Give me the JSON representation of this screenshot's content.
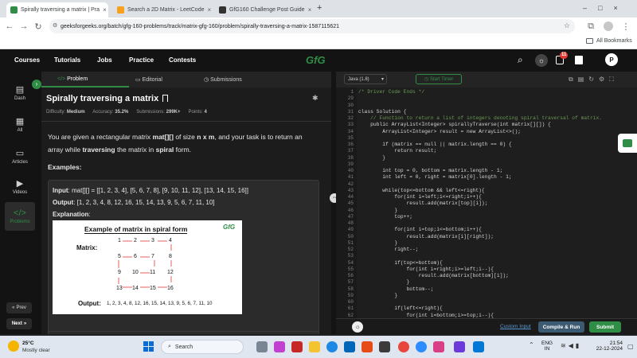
{
  "browser": {
    "tabs": [
      {
        "title": "Spirally traversing a matrix | Pra",
        "active": true,
        "favicon_color": "#2f8d46"
      },
      {
        "title": "Search a 2D Matrix - LeetCode",
        "active": false,
        "favicon_color": "#f89f1b"
      },
      {
        "title": "GfG160 Challenge Post Guide",
        "active": false,
        "favicon_color": "#333333"
      }
    ],
    "new_tab": "+",
    "url": "geeksforgeeks.org/batch/gfg-160-problems/track/matrix-gfg-160/problem/spirally-traversing-a-matrix-1587115621",
    "all_bookmarks": "All Bookmarks"
  },
  "gfg_nav": {
    "items": [
      "Courses",
      "Tutorials",
      "Jobs",
      "Practice",
      "Contests"
    ],
    "logo": "GfG",
    "notification_count": "11",
    "avatar": "P"
  },
  "rail": {
    "items": [
      {
        "label": "Dash",
        "icon": "dashboard-icon"
      },
      {
        "label": "All",
        "icon": "all-icon"
      },
      {
        "label": "Articles",
        "icon": "articles-icon"
      },
      {
        "label": "Videos",
        "icon": "videos-icon"
      },
      {
        "label": "Problems",
        "icon": "problems-icon"
      }
    ],
    "prev": "Prev",
    "next": "Next"
  },
  "problem": {
    "tabs": [
      "Problem",
      "Editorial",
      "Submissions"
    ],
    "title": "Spirally traversing a matrix",
    "meta": {
      "difficulty_label": "Difficulty:",
      "difficulty": "Medium",
      "accuracy_label": "Accuracy:",
      "accuracy": "35.2%",
      "submissions_label": "Submissions:",
      "submissions": "299K+",
      "points_label": "Points:",
      "points": "4"
    },
    "statement_parts": {
      "p1": "You are given a rectangular matrix ",
      "b1": "mat[][]",
      "p2": " of size ",
      "b2": "n x m",
      "p3": ", and your task is to return an array while ",
      "b3": "traversing",
      "p4": " the matrix in ",
      "b4": "spiral",
      "p5": " form."
    },
    "examples_label": "Examples:",
    "example": {
      "input_label": "Input",
      "input": ":  mat[][] = [[1, 2, 3, 4], [5, 6, 7, 8], [9, 10, 11, 12], [13, 14, 15, 16]]",
      "output_label": "Output",
      "output": ":  [1, 2, 3, 4, 8, 12, 16, 15, 14, 13, 9, 5, 6, 7, 11, 10]",
      "explanation_label": "Explanation",
      "explanation_colon": ":",
      "image": {
        "heading": "Example of matrix in spiral form",
        "logo": "GfG",
        "matrix_label": "Matrix:",
        "rows": [
          [
            "1",
            "2",
            "3",
            "4"
          ],
          [
            "5",
            "6",
            "7",
            "8"
          ],
          [
            "9",
            "10",
            "11",
            "12"
          ],
          [
            "13",
            "14",
            "15",
            "16"
          ]
        ],
        "output_label": "Output:",
        "output": "1, 2, 3, 4, 8, 12, 16, 15, 14, 13, 9, 5, 6, 7, 11, 10"
      }
    }
  },
  "editor": {
    "language": "Java (1.8)",
    "start_timer": "Start Timer",
    "custom_input": "Custom Input",
    "compile_run": "Compile & Run",
    "submit": "Submit",
    "lines": [
      {
        "n": "1",
        "t": "/* Driver Code Ends */",
        "c": "#6a9955"
      },
      {
        "n": "29",
        "t": "",
        "c": "#d4d4d4"
      },
      {
        "n": "30",
        "t": "",
        "c": "#d4d4d4"
      },
      {
        "n": "31",
        "t": "class Solution {",
        "c": "#d4d4d4"
      },
      {
        "n": "32",
        "t": "    // Function to return a list of integers denoting spiral traversal of matrix.",
        "c": "#6a9955"
      },
      {
        "n": "33",
        "t": "    public ArrayList<Integer> spirallyTraverse(int matrix[][]) {",
        "c": "#d4d4d4"
      },
      {
        "n": "34",
        "t": "        ArrayList<Integer> result = new ArrayList<>();",
        "c": "#d4d4d4"
      },
      {
        "n": "35",
        "t": "",
        "c": "#d4d4d4"
      },
      {
        "n": "36",
        "t": "        if (matrix == null || matrix.length == 0) {",
        "c": "#d4d4d4"
      },
      {
        "n": "37",
        "t": "            return result;",
        "c": "#d4d4d4"
      },
      {
        "n": "38",
        "t": "        }",
        "c": "#d4d4d4"
      },
      {
        "n": "39",
        "t": "",
        "c": "#d4d4d4"
      },
      {
        "n": "40",
        "t": "        int top = 0, bottom = matrix.length - 1;",
        "c": "#d4d4d4"
      },
      {
        "n": "41",
        "t": "        int left = 0, right = matrix[0].length - 1;",
        "c": "#d4d4d4"
      },
      {
        "n": "42",
        "t": "",
        "c": "#d4d4d4"
      },
      {
        "n": "43",
        "t": "        while(top<=bottom && left<=right){",
        "c": "#d4d4d4"
      },
      {
        "n": "44",
        "t": "            for(int i=left;i<=right;i++){",
        "c": "#d4d4d4"
      },
      {
        "n": "45",
        "t": "                result.add(matrix[top][i]);",
        "c": "#d4d4d4"
      },
      {
        "n": "46",
        "t": "            }",
        "c": "#d4d4d4"
      },
      {
        "n": "47",
        "t": "            top++;",
        "c": "#d4d4d4"
      },
      {
        "n": "48",
        "t": "",
        "c": "#d4d4d4"
      },
      {
        "n": "49",
        "t": "            for(int i=top;i<=bottom;i++){",
        "c": "#d4d4d4"
      },
      {
        "n": "50",
        "t": "                result.add(matrix[i][right]);",
        "c": "#d4d4d4"
      },
      {
        "n": "51",
        "t": "            }",
        "c": "#d4d4d4"
      },
      {
        "n": "52",
        "t": "            right--;",
        "c": "#d4d4d4"
      },
      {
        "n": "53",
        "t": "",
        "c": "#d4d4d4"
      },
      {
        "n": "54",
        "t": "            if(top<=bottom){",
        "c": "#d4d4d4"
      },
      {
        "n": "55",
        "t": "                for(int i=right;i>=left;i--){",
        "c": "#d4d4d4"
      },
      {
        "n": "56",
        "t": "                    result.add(matrix[bottom][i]);",
        "c": "#d4d4d4"
      },
      {
        "n": "57",
        "t": "                }",
        "c": "#d4d4d4"
      },
      {
        "n": "58",
        "t": "                bottom--;",
        "c": "#d4d4d4"
      },
      {
        "n": "59",
        "t": "            }",
        "c": "#d4d4d4"
      },
      {
        "n": "60",
        "t": "",
        "c": "#d4d4d4"
      },
      {
        "n": "61",
        "t": "            if(left<=right){",
        "c": "#d4d4d4"
      },
      {
        "n": "62",
        "t": "                for(int i=bottom;i>=top;i--){",
        "c": "#d4d4d4"
      }
    ]
  },
  "taskbar": {
    "temperature": "25°C",
    "weather": "Mostly clear",
    "search": "Search",
    "lang1": "ENG",
    "lang2": "IN",
    "time": "21:54",
    "date": "22-12-2024"
  },
  "colors": {
    "gfg_green": "#2f8d46",
    "submit_green": "#2f8d46",
    "compile": "#3d5a73"
  }
}
